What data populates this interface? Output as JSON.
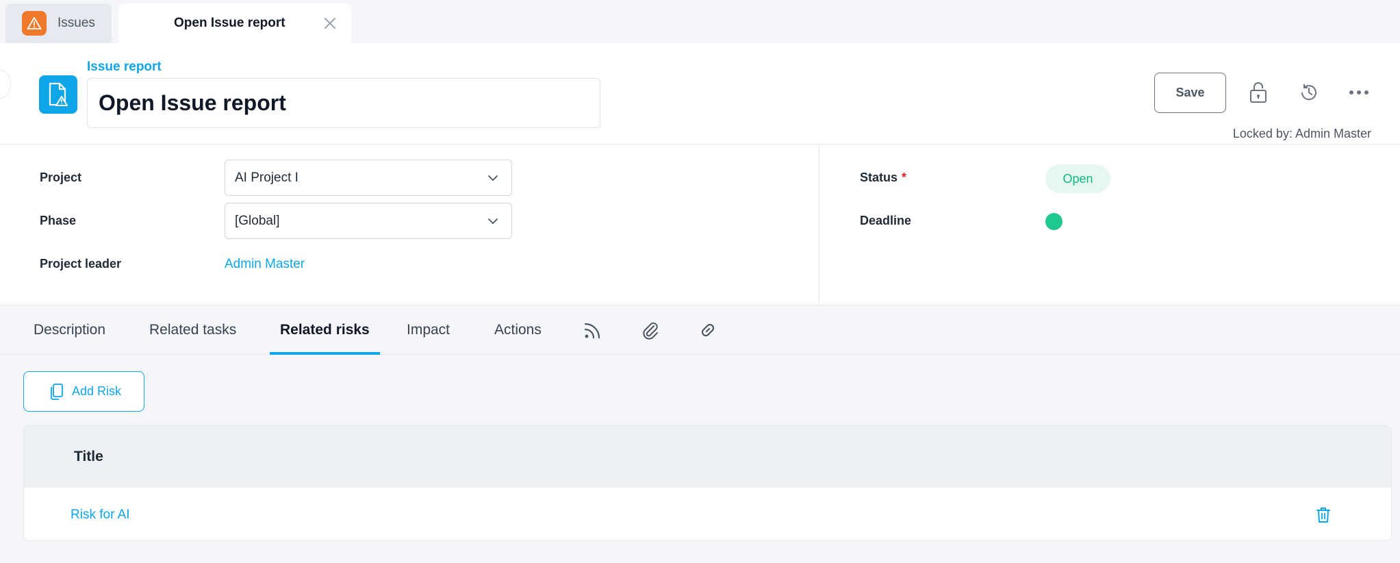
{
  "tabs": {
    "issues_label": "Issues",
    "active_label": "Open Issue report"
  },
  "header": {
    "breadcrumb": "Issue report",
    "title_value": "Open Issue report",
    "save_label": "Save",
    "locked_by": "Locked by: Admin Master"
  },
  "form": {
    "project_label": "Project",
    "project_value": "AI Project I",
    "phase_label": "Phase",
    "phase_value": "[Global]",
    "leader_label": "Project leader",
    "leader_value": "Admin Master",
    "status_label": "Status",
    "status_required": "*",
    "status_value": "Open",
    "deadline_label": "Deadline"
  },
  "section_tabs": [
    {
      "label": "Description"
    },
    {
      "label": "Related tasks"
    },
    {
      "label": "Related risks"
    },
    {
      "label": "Impact"
    },
    {
      "label": "Actions"
    }
  ],
  "section_icons": [
    "rss-icon",
    "paperclip-icon",
    "link-icon"
  ],
  "content": {
    "add_risk_label": "Add Risk",
    "table_header_title": "Title",
    "rows": [
      {
        "title": "Risk for AI"
      }
    ]
  },
  "colors": {
    "accent": "#0ea5e9",
    "issue_icon": "#f07a2b",
    "status_green": "#10b981",
    "deadline_dot": "#1fc98e"
  }
}
